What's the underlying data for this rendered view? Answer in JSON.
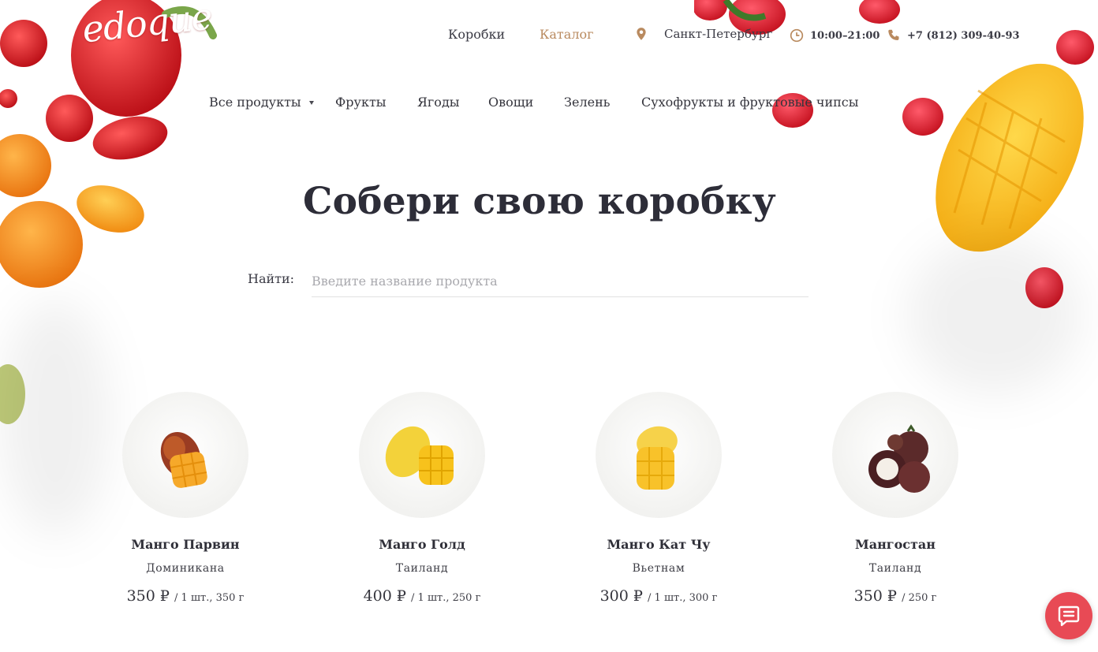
{
  "brand": {
    "logo": "edoque"
  },
  "topnav": {
    "boxes": "Коробки",
    "catalog": "Каталог"
  },
  "contacts": {
    "city": "Санкт-Петербург",
    "hours": "10:00–21:00",
    "phone": "+7 (812) 309-40-93"
  },
  "categories": [
    "Все продукты",
    "Фрукты",
    "Ягоды",
    "Овощи",
    "Зелень",
    "Сухофрукты и фруктовые чипсы"
  ],
  "hero": {
    "title": "Собери свою коробку"
  },
  "search": {
    "label": "Найти:",
    "placeholder": "Введите название продукта"
  },
  "products": [
    {
      "name": "Манго Парвин",
      "origin": "Доминикана",
      "price": "350 ₽",
      "unit": "/ 1 шт., 350 г"
    },
    {
      "name": "Манго Голд",
      "origin": "Таиланд",
      "price": "400 ₽",
      "unit": "/ 1 шт., 250 г"
    },
    {
      "name": "Манго Кат Чу",
      "origin": "Вьетнам",
      "price": "300 ₽",
      "unit": "/ 1 шт., 300 г"
    },
    {
      "name": "Мангостан",
      "origin": "Таиланд",
      "price": "350 ₽",
      "unit": "/ 250 г"
    }
  ],
  "colors": {
    "accent": "#b98a5f",
    "chat": "#e84a55",
    "text": "#2d2d38"
  },
  "icons": {
    "location": "map-pin-icon",
    "hours": "clock-icon",
    "phone": "phone-icon",
    "chat": "chat-icon"
  }
}
